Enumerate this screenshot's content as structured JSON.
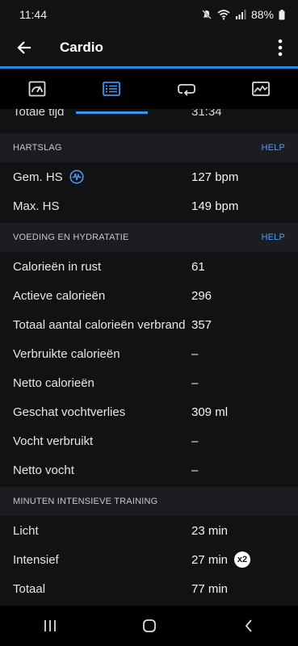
{
  "status": {
    "time": "11:44",
    "battery": "88%"
  },
  "appbar": {
    "title": "Cardio"
  },
  "tabs": [
    {
      "icon": "gauge-icon",
      "active": false
    },
    {
      "icon": "list-icon",
      "active": true
    },
    {
      "icon": "laps-icon",
      "active": false
    },
    {
      "icon": "chart-icon",
      "active": false
    }
  ],
  "cutoff": {
    "label": "Totale tijd",
    "value": "31:34"
  },
  "hartslag": {
    "title": "HARTSLAG",
    "help": "HELP",
    "rows": [
      {
        "label": "Gem. HS",
        "value": "127 bpm"
      },
      {
        "label": "Max. HS",
        "value": "149 bpm"
      }
    ]
  },
  "voeding": {
    "title": "VOEDING EN HYDRATATIE",
    "help": "HELP",
    "rows": [
      {
        "label": "Calorieën in rust",
        "value": "61"
      },
      {
        "label": "Actieve calorieën",
        "value": "296"
      },
      {
        "label": "Totaal aantal calorieën verbrand",
        "value": "357"
      },
      {
        "label": "Verbruikte calorieën",
        "value": "–"
      },
      {
        "label": "Netto calorieën",
        "value": "–"
      },
      {
        "label": "Geschat vochtverlies",
        "value": "309 ml"
      },
      {
        "label": "Vocht verbruikt",
        "value": "–"
      },
      {
        "label": "Netto vocht",
        "value": "–"
      }
    ]
  },
  "minuten": {
    "title": "MINUTEN INTENSIEVE TRAINING",
    "rows": [
      {
        "label": "Licht",
        "value": "23 min"
      },
      {
        "label": "Intensief",
        "value": "27 min",
        "badge": "x2"
      },
      {
        "label": "Totaal",
        "value": "77 min"
      }
    ]
  },
  "colors": {
    "accent": "#3d95f0",
    "background": "#111214",
    "header": "#1c1d20"
  }
}
